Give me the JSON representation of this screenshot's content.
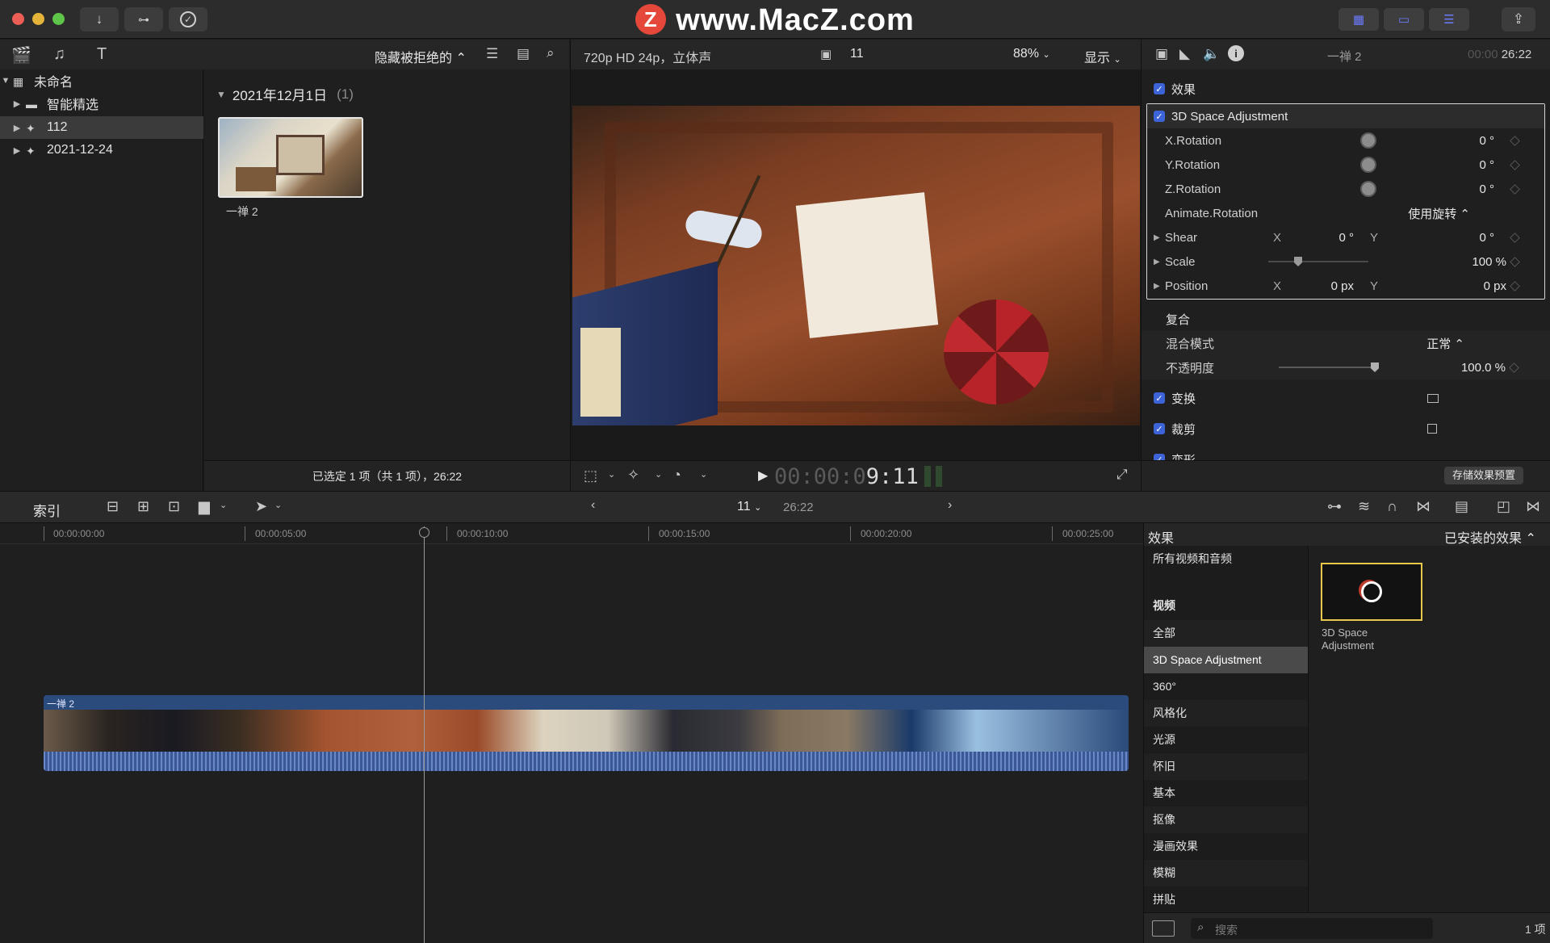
{
  "watermark": {
    "logo": "Z",
    "text": "www.MacZ.com"
  },
  "titlebar": {
    "icons": [
      "download-icon",
      "key-icon",
      "checkmark-icon"
    ]
  },
  "library": {
    "filter_label": "隐藏被拒绝的 ⌃",
    "items": [
      {
        "label": "未命名",
        "arrow": "▼"
      },
      {
        "label": "智能精选",
        "arrow": "▶"
      },
      {
        "label": "112",
        "arrow": "▶"
      },
      {
        "label": "2021-12-24",
        "arrow": "▶"
      }
    ]
  },
  "browser": {
    "date_header": "2021年12月1日",
    "count": "(1)",
    "clip_name": "一禅 2",
    "footer": "已选定 1 项（共 1 项），26:22"
  },
  "viewer": {
    "format": "720p HD 24p，立体声",
    "project_number": "11",
    "zoom": "88%",
    "display_label": "显示",
    "timecode_dim": "00:00:0",
    "timecode_bright": "9:11"
  },
  "inspector": {
    "clip_name": "一禅 2",
    "duration_dim": "00:00",
    "duration": "26:22",
    "effects_label": "效果",
    "effect_name": "3D Space Adjustment",
    "params": {
      "x_rotation": {
        "label": "X.Rotation",
        "value": "0",
        "unit": "°"
      },
      "y_rotation": {
        "label": "Y.Rotation",
        "value": "0",
        "unit": "°"
      },
      "z_rotation": {
        "label": "Z.Rotation",
        "value": "0",
        "unit": "°"
      },
      "animate_rotation": {
        "label": "Animate.Rotation",
        "value": "使用旋转 ⌃"
      },
      "shear": {
        "label": "Shear",
        "x_label": "X",
        "x": "0",
        "x_unit": "°",
        "y_label": "Y",
        "y": "0",
        "y_unit": "°"
      },
      "scale": {
        "label": "Scale",
        "value": "100",
        "unit": "%"
      },
      "position": {
        "label": "Position",
        "x_label": "X",
        "x": "0",
        "x_unit": "px",
        "y_label": "Y",
        "y": "0",
        "y_unit": "px"
      }
    },
    "composite_label": "复合",
    "blend_mode_label": "混合模式",
    "blend_mode_value": "正常 ⌃",
    "opacity_label": "不透明度",
    "opacity_value": "100.0",
    "opacity_unit": "%",
    "transform_label": "变换",
    "crop_label": "裁剪",
    "distort_label": "变形",
    "save_preset_label": "存储效果预置"
  },
  "timeline": {
    "index_label": "索引",
    "project_number": "11",
    "duration": "26:22",
    "ruler": [
      "00:00:00:00",
      "00:00:05:00",
      "00:00:10:00",
      "00:00:15:00",
      "00:00:20:00",
      "00:00:25:00"
    ],
    "clip_label": "一禅 2"
  },
  "effects_browser": {
    "title": "效果",
    "filter": "已安装的效果 ⌃",
    "categories": [
      "所有视频和音频",
      "视频",
      "全部",
      "3D Space Adjustment",
      "360°",
      "风格化",
      "光源",
      "怀旧",
      "基本",
      "抠像",
      "漫画效果",
      "模糊",
      "拼贴"
    ],
    "selected_category": "3D Space Adjustment",
    "item_label": "3D Space Adjustment",
    "search_placeholder": "搜索",
    "item_count": "1 项"
  },
  "colors": {
    "accent": "#6b7bff",
    "checkbox": "#3d63d9",
    "clip": "#2c4b7d",
    "highlight": "#e8c84a"
  }
}
